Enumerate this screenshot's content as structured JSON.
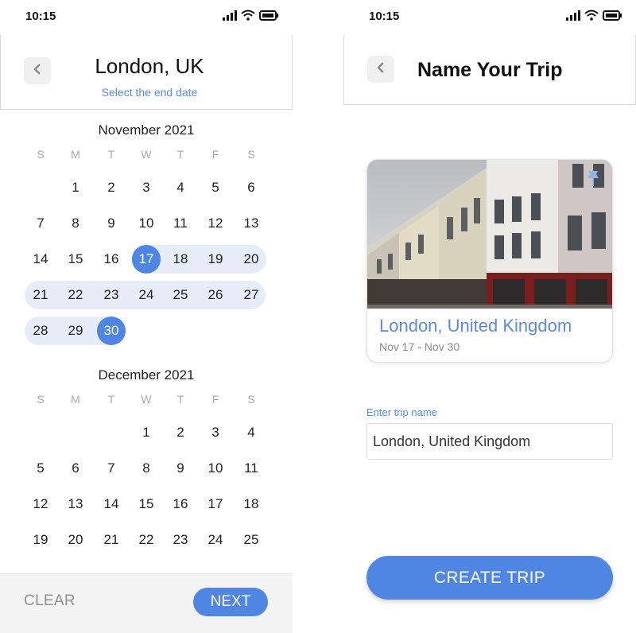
{
  "colors": {
    "accent": "#4f86e3",
    "range": "#e6edf9",
    "link": "#5a8be0"
  },
  "left": {
    "status_time": "10:15",
    "header": {
      "title": "London, UK",
      "subtitle": "Select the end date"
    },
    "weekday_labels": [
      "S",
      "M",
      "T",
      "W",
      "T",
      "F",
      "S"
    ],
    "months": [
      {
        "title": "November 2021",
        "weeks": [
          [
            "",
            "1",
            "2",
            "3",
            "4",
            "5",
            "6"
          ],
          [
            "7",
            "8",
            "9",
            "10",
            "11",
            "12",
            "13"
          ],
          [
            "14",
            "15",
            "16",
            "17",
            "18",
            "19",
            "20"
          ],
          [
            "21",
            "22",
            "23",
            "24",
            "25",
            "26",
            "27"
          ],
          [
            "28",
            "29",
            "30",
            "",
            "",
            "",
            ""
          ]
        ],
        "range": {
          "start": "17",
          "end": "30"
        }
      },
      {
        "title": "December 2021",
        "weeks": [
          [
            "",
            "",
            "",
            "1",
            "2",
            "3",
            "4"
          ],
          [
            "5",
            "6",
            "7",
            "8",
            "9",
            "10",
            "11"
          ],
          [
            "12",
            "13",
            "14",
            "15",
            "16",
            "17",
            "18"
          ],
          [
            "19",
            "20",
            "21",
            "22",
            "23",
            "24",
            "25"
          ]
        ]
      }
    ],
    "footer": {
      "clear_label": "CLEAR",
      "next_label": "NEXT"
    }
  },
  "right": {
    "status_time": "10:15",
    "header": {
      "title": "Name Your Trip"
    },
    "card": {
      "name": "London, United Kingdom",
      "dates": "Nov 17 - Nov 30"
    },
    "field": {
      "label": "Enter trip name",
      "value": "London, United Kingdom"
    },
    "create_label": "CREATE TRIP"
  }
}
